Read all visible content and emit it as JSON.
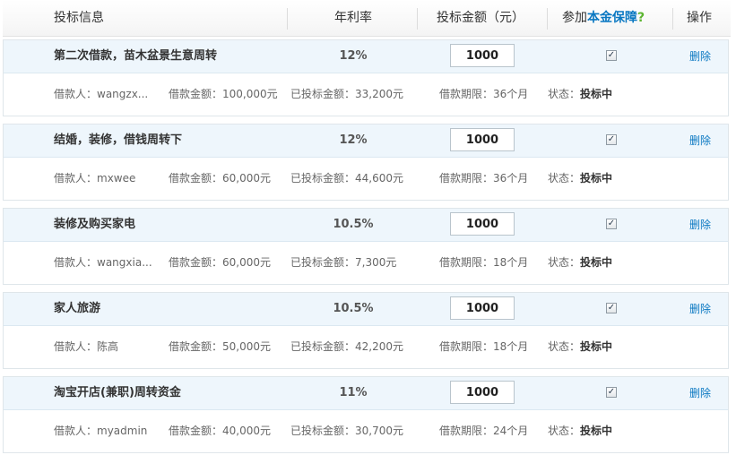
{
  "header": {
    "title": "投标信息",
    "rate": "年利率",
    "amount": "投标金额（元）",
    "guarantee_prefix": "参加",
    "guarantee_link": "本金保障",
    "guarantee_help": "?",
    "operation": "操作"
  },
  "labels": {
    "borrower": "借款人：",
    "loan_amount": "借款金额：",
    "invested": "已投标金额：",
    "term": "借款期限：",
    "status": "状态："
  },
  "colors": {
    "accent_blue": "#0a78c2",
    "help_green": "#5cb531",
    "row_header_bg": "#eef6fc"
  },
  "loans": [
    {
      "title": "第二次借款，苗木盆景生意周转",
      "rate": "12%",
      "bid_amount": "1000",
      "guaranteed": true,
      "delete_label": "删除",
      "borrower": "wangzx...",
      "loan_amount": "100,000元",
      "invested": "33,200元",
      "term": "36个月",
      "status": "投标中"
    },
    {
      "title": "结婚，装修，借钱周转下",
      "rate": "12%",
      "bid_amount": "1000",
      "guaranteed": true,
      "delete_label": "删除",
      "borrower": "mxwee",
      "loan_amount": "60,000元",
      "invested": "44,600元",
      "term": "36个月",
      "status": "投标中"
    },
    {
      "title": "装修及购买家电",
      "rate": "10.5%",
      "bid_amount": "1000",
      "guaranteed": true,
      "delete_label": "删除",
      "borrower": "wangxia...",
      "loan_amount": "60,000元",
      "invested": "7,300元",
      "term": "18个月",
      "status": "投标中"
    },
    {
      "title": "家人旅游",
      "rate": "10.5%",
      "bid_amount": "1000",
      "guaranteed": true,
      "delete_label": "删除",
      "borrower": "陈高",
      "loan_amount": "50,000元",
      "invested": "42,200元",
      "term": "18个月",
      "status": "投标中"
    },
    {
      "title": "淘宝开店(兼职)周转资金",
      "rate": "11%",
      "bid_amount": "1000",
      "guaranteed": true,
      "delete_label": "删除",
      "borrower": "myadmin",
      "loan_amount": "40,000元",
      "invested": "30,700元",
      "term": "24个月",
      "status": "投标中"
    }
  ]
}
